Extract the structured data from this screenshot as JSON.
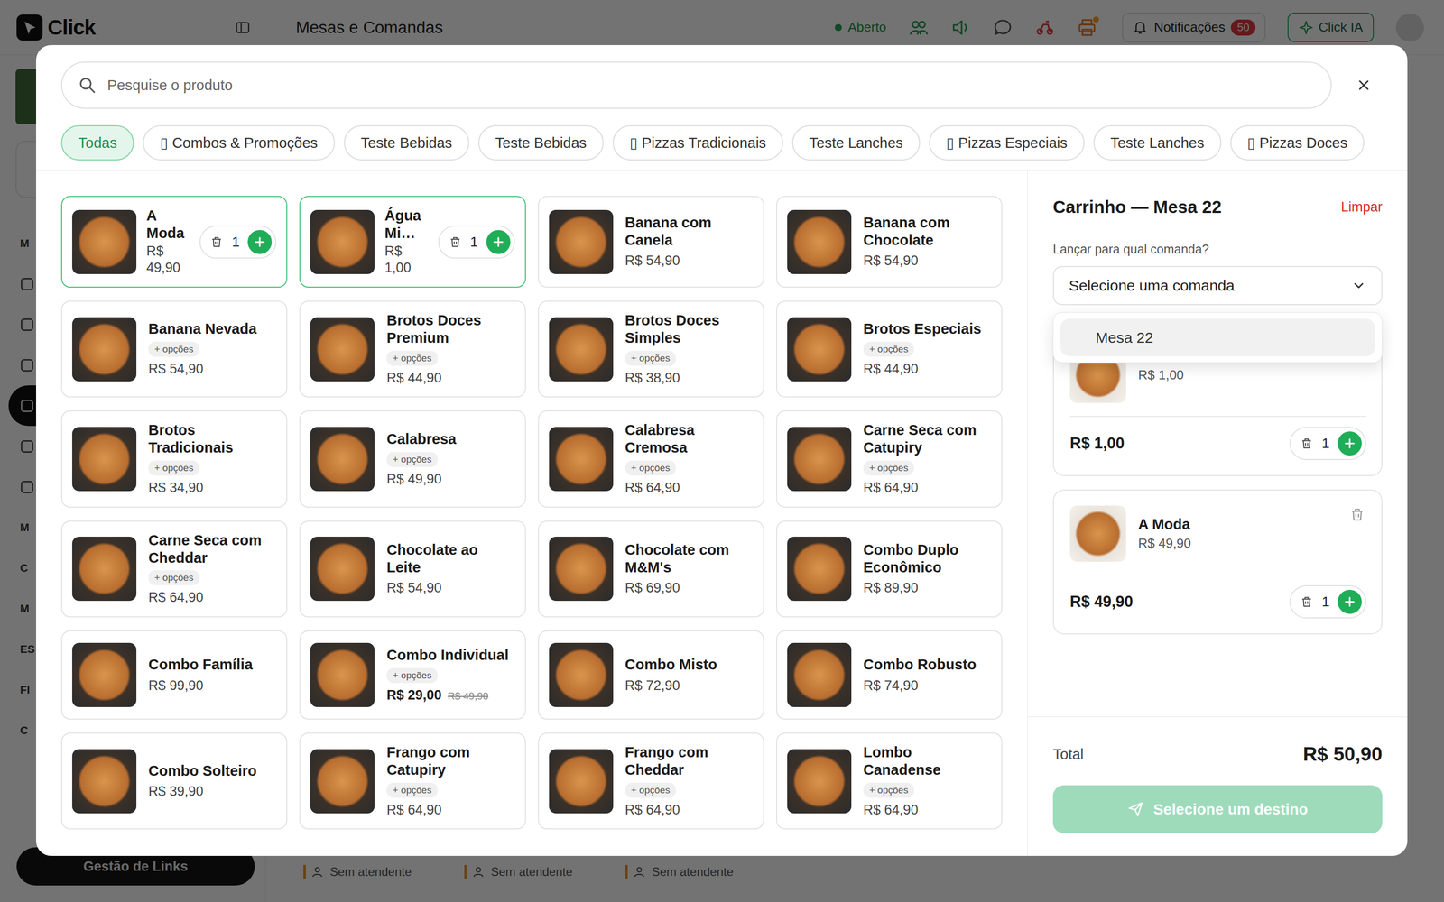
{
  "app": {
    "logo": "Click",
    "title": "Mesas e Comandas",
    "status": {
      "label": "Aberto",
      "open": true
    },
    "notifications": {
      "label": "Notificações",
      "count": "50"
    },
    "assistant": {
      "label": "Click IA"
    },
    "sidebar": {
      "items": [
        {
          "kind": "label",
          "label": "M",
          "active": false
        },
        {
          "kind": "icon",
          "active": false
        },
        {
          "kind": "icon",
          "active": false
        },
        {
          "kind": "icon",
          "active": false
        },
        {
          "kind": "icon",
          "active": true
        },
        {
          "kind": "icon",
          "active": false
        },
        {
          "kind": "icon",
          "active": false
        },
        {
          "kind": "label",
          "label": "M",
          "active": false
        },
        {
          "kind": "label",
          "label": "C",
          "active": false
        },
        {
          "kind": "label",
          "label": "M",
          "active": false
        },
        {
          "kind": "label",
          "label": "ES",
          "active": false
        },
        {
          "kind": "label",
          "label": "Fl",
          "active": false
        },
        {
          "kind": "label",
          "label": "C",
          "active": false
        }
      ],
      "footer_button": "Gestão de Links"
    },
    "tables": [
      {
        "attendant": "Sem atendente"
      },
      {
        "attendant": "Sem atendente"
      },
      {
        "attendant": "Sem atendente"
      }
    ]
  },
  "modal": {
    "search": {
      "placeholder": "Pesquise o produto"
    },
    "categories": [
      {
        "label": "Todas",
        "selected": true
      },
      {
        "label": "▯ Combos & Promoções",
        "selected": false
      },
      {
        "label": "Teste Bebidas",
        "selected": false
      },
      {
        "label": "Teste Bebidas",
        "selected": false
      },
      {
        "label": "▯ Pizzas Tradicionais",
        "selected": false
      },
      {
        "label": "Teste Lanches",
        "selected": false
      },
      {
        "label": "▯ Pizzas Especiais",
        "selected": false
      },
      {
        "label": "Teste Lanches",
        "selected": false
      },
      {
        "label": "▯ Pizzas Doces",
        "selected": false
      }
    ],
    "products": [
      {
        "name": "A Moda",
        "price": "R$ 49,90",
        "in_cart": true,
        "quantity": "1"
      },
      {
        "name": "Água Mi…",
        "price": "R$ 1,00",
        "in_cart": true,
        "quantity": "1"
      },
      {
        "name": "Banana com Canela",
        "price": "R$ 54,90",
        "in_cart": false
      },
      {
        "name": "Banana com Chocolate",
        "price": "R$ 54,90",
        "in_cart": false
      },
      {
        "name": "Banana Nevada",
        "options_tag": "+ opções",
        "price": "R$ 54,90",
        "in_cart": false
      },
      {
        "name": "Brotos Doces Premium",
        "options_tag": "+ opções",
        "price": "R$ 44,90",
        "in_cart": false
      },
      {
        "name": "Brotos Doces Simples",
        "options_tag": "+ opções",
        "price": "R$ 38,90",
        "in_cart": false
      },
      {
        "name": "Brotos Especiais",
        "options_tag": "+ opções",
        "price": "R$ 44,90",
        "in_cart": false
      },
      {
        "name": "Brotos Tradicionais",
        "options_tag": "+ opções",
        "price": "R$ 34,90",
        "in_cart": false
      },
      {
        "name": "Calabresa",
        "options_tag": "+ opções",
        "price": "R$ 49,90",
        "in_cart": false
      },
      {
        "name": "Calabresa Cremosa",
        "options_tag": "+ opções",
        "price": "R$ 64,90",
        "in_cart": false
      },
      {
        "name": "Carne Seca com Catupiry",
        "options_tag": "+ opções",
        "price": "R$ 64,90",
        "in_cart": false
      },
      {
        "name": "Carne Seca com Cheddar",
        "options_tag": "+ opções",
        "price": "R$ 64,90",
        "in_cart": false
      },
      {
        "name": "Chocolate ao Leite",
        "price": "R$ 54,90",
        "in_cart": false
      },
      {
        "name": "Chocolate com M&M's",
        "price": "R$ 69,90",
        "in_cart": false
      },
      {
        "name": "Combo Duplo Econômico",
        "price": "R$ 89,90",
        "in_cart": false
      },
      {
        "name": "Combo Família",
        "price": "R$ 99,90",
        "in_cart": false
      },
      {
        "name": "Combo Individual",
        "options_tag": "+ opções",
        "price": "R$ 29,00",
        "old_price": "R$ 49,90",
        "in_cart": false
      },
      {
        "name": "Combo Misto",
        "price": "R$ 72,90",
        "in_cart": false
      },
      {
        "name": "Combo Robusto",
        "price": "R$ 74,90",
        "in_cart": false
      },
      {
        "name": "Combo Solteiro",
        "price": "R$ 39,90",
        "in_cart": false
      },
      {
        "name": "Frango com Catupiry",
        "options_tag": "+ opções",
        "price": "R$ 64,90",
        "in_cart": false
      },
      {
        "name": "Frango com Cheddar",
        "options_tag": "+ opções",
        "price": "R$ 64,90",
        "in_cart": false
      },
      {
        "name": "Lombo Canadense",
        "options_tag": "+ opções",
        "price": "R$ 64,90",
        "in_cart": false
      }
    ],
    "cart": {
      "title": "Carrinho — Mesa 22",
      "clear": "Limpar",
      "target_label": "Lançar para qual comanda?",
      "select": {
        "placeholder": "Selecione uma comanda",
        "open": true,
        "options": [
          {
            "label": "Mesa 22",
            "highlighted": true
          }
        ]
      },
      "items": [
        {
          "price": "R$ 1,00",
          "line_total": "R$ 1,00",
          "quantity": "1"
        },
        {
          "name": "A Moda",
          "price": "R$ 49,90",
          "line_total": "R$ 49,90",
          "quantity": "1"
        }
      ],
      "total_label": "Total",
      "total": "R$ 50,90",
      "submit": {
        "label": "Selecione um destino",
        "disabled": true
      }
    }
  }
}
